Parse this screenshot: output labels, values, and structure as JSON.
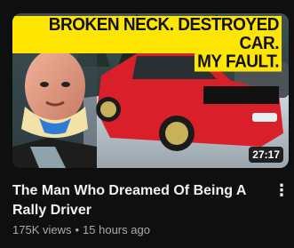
{
  "video": {
    "thumbnail_text_line1": "BROKEN NECK. DESTROYED CAR.",
    "thumbnail_text_line2": "MY FAULT.",
    "duration": "27:17",
    "title": "The Man Who Dreamed Of Being A Rally Driver",
    "views": "175K views",
    "age": "15 hours ago",
    "more_icon": "vertical-dots-icon"
  },
  "colors": {
    "background": "#0f0f0f",
    "headline_bg": "#ffe600",
    "car_red": "#d81f2a",
    "meta_text": "#aaaaaa"
  }
}
